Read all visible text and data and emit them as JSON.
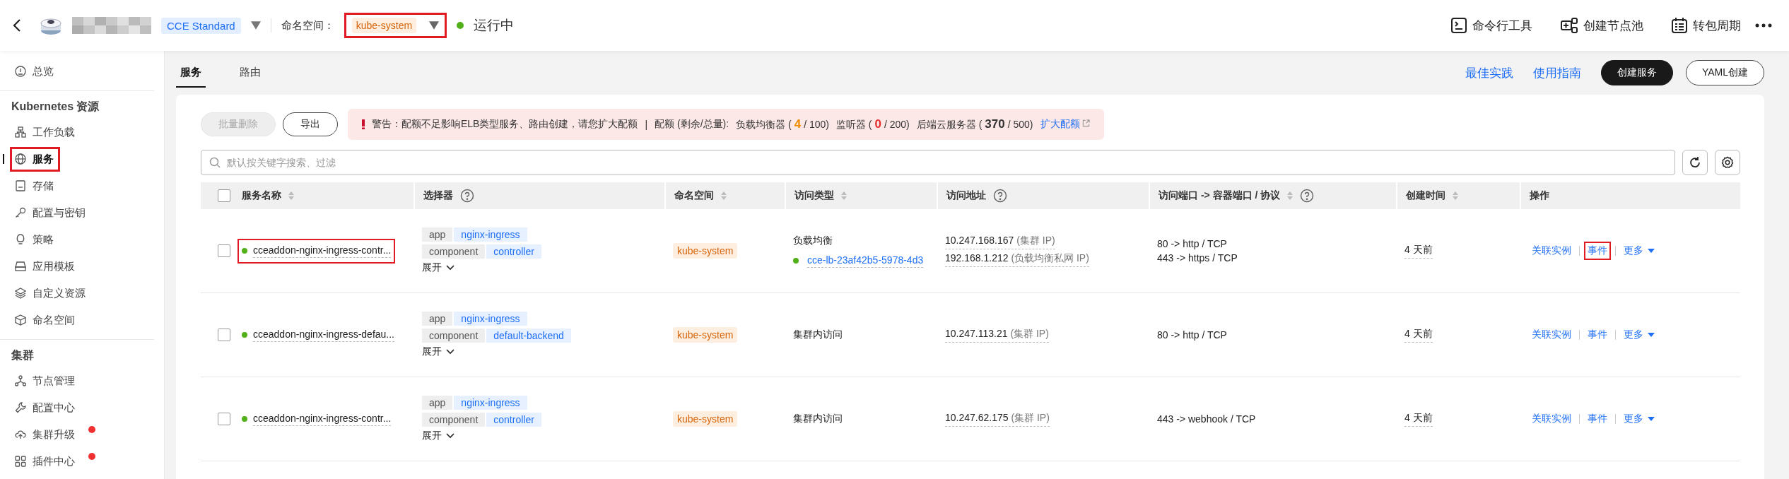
{
  "topbar": {
    "cluster_badge": "CCE Standard",
    "namespace_label": "命名空间：",
    "namespace": {
      "value": "kube-system",
      "highlighted": true
    },
    "status": "运行中",
    "actions": [
      {
        "label": "命令行工具"
      },
      {
        "label": "创建节点池"
      },
      {
        "label": "转包周期"
      }
    ]
  },
  "sidebar": {
    "sections": [
      {
        "items": [
          {
            "label": "总览",
            "selected": false,
            "highlighted": false,
            "alert": false
          }
        ]
      },
      {
        "title": "Kubernetes 资源",
        "items": [
          {
            "label": "工作负载",
            "selected": false,
            "highlighted": false,
            "alert": false
          },
          {
            "label": "服务",
            "selected": true,
            "highlighted": true,
            "alert": false
          },
          {
            "label": "存储",
            "selected": false,
            "highlighted": false,
            "alert": false
          },
          {
            "label": "配置与密钥",
            "selected": false,
            "highlighted": false,
            "alert": false
          },
          {
            "label": "策略",
            "selected": false,
            "highlighted": false,
            "alert": false
          },
          {
            "label": "应用模板",
            "selected": false,
            "highlighted": false,
            "alert": false
          },
          {
            "label": "自定义资源",
            "selected": false,
            "highlighted": false,
            "alert": false
          },
          {
            "label": "命名空间",
            "selected": false,
            "highlighted": false,
            "alert": false
          }
        ]
      },
      {
        "title": "集群",
        "items": [
          {
            "label": "节点管理",
            "selected": false,
            "highlighted": false,
            "alert": false
          },
          {
            "label": "配置中心",
            "selected": false,
            "highlighted": false,
            "alert": false
          },
          {
            "label": "集群升级",
            "selected": false,
            "highlighted": false,
            "alert": true
          },
          {
            "label": "插件中心",
            "selected": false,
            "highlighted": false,
            "alert": true
          }
        ]
      }
    ]
  },
  "tabs": [
    {
      "label": "服务",
      "selected": true
    },
    {
      "label": "路由",
      "selected": false
    }
  ],
  "header_links": [
    "最佳实践",
    "使用指南"
  ],
  "header_buttons": [
    {
      "label": "创建服务",
      "primary": true
    },
    {
      "label": "YAML创建",
      "primary": false
    }
  ],
  "toolbar": {
    "buttons": [
      {
        "label": "批量删除",
        "disabled": true
      },
      {
        "label": "导出",
        "disabled": false
      }
    ]
  },
  "warning": {
    "message": "警告：配额不足影响ELB类型服务、路由创建，请您扩大配额",
    "separator": "|",
    "quota_label": "配额 (剩余/总量):",
    "quotas": [
      {
        "label": "负载均衡器 (",
        "value": "4",
        "total": "/ 100)",
        "color": "#f08c00"
      },
      {
        "label": "监听器 (",
        "value": "0",
        "total": "/ 200)",
        "color": "#e62e2e"
      },
      {
        "label": "后端云服务器 (",
        "value": "370",
        "total": "/ 500)",
        "color": "#333333"
      }
    ],
    "link": "扩大配额"
  },
  "search": {
    "placeholder": "默认按关键字搜索、过滤"
  },
  "table": {
    "select_all": {
      "checked": false
    },
    "columns": [
      {
        "label": "服务名称",
        "sortable": true,
        "help": false
      },
      {
        "label": "选择器",
        "sortable": false,
        "help": true
      },
      {
        "label": "命名空间",
        "sortable": true,
        "help": false
      },
      {
        "label": "访问类型",
        "sortable": true,
        "help": false
      },
      {
        "label": "访问地址",
        "sortable": false,
        "help": true
      },
      {
        "label": "访问端口 -> 容器端口 / 协议",
        "sortable": true,
        "help": true
      },
      {
        "label": "创建时间",
        "sortable": true,
        "help": false
      },
      {
        "label": "操作",
        "sortable": false,
        "help": false
      }
    ],
    "rows": [
      {
        "checked": false,
        "name": "cceaddon-nginx-ingress-contr...",
        "name_highlighted": true,
        "selector": [
          {
            "key": "app",
            "value": "nginx-ingress"
          },
          {
            "key": "component",
            "value": "controller"
          }
        ],
        "expand": "展开",
        "namespace": "kube-system",
        "access_type": "负载均衡",
        "load_balancer": "cce-lb-23af42b5-5978-4d3",
        "addresses": [
          {
            "ip": "10.247.168.167",
            "note": "(集群 IP)"
          },
          {
            "ip": "192.168.1.212",
            "note": "(负载均衡私网 IP)"
          }
        ],
        "ports": [
          "80 -> http / TCP",
          "443 -> https / TCP"
        ],
        "created": "4 天前",
        "actions": [
          {
            "label": "关联实例",
            "highlighted": false
          },
          {
            "label": "事件",
            "highlighted": true
          },
          {
            "label": "更多",
            "highlighted": false
          }
        ]
      },
      {
        "checked": false,
        "name": "cceaddon-nginx-ingress-defau...",
        "name_highlighted": false,
        "selector": [
          {
            "key": "app",
            "value": "nginx-ingress"
          },
          {
            "key": "component",
            "value": "default-backend"
          }
        ],
        "expand": "展开",
        "namespace": "kube-system",
        "access_type": "集群内访问",
        "addresses": [
          {
            "ip": "10.247.113.21",
            "note": "(集群 IP)"
          }
        ],
        "ports": [
          "80 -> http / TCP"
        ],
        "created": "4 天前",
        "actions": [
          {
            "label": "关联实例",
            "highlighted": false
          },
          {
            "label": "事件",
            "highlighted": false
          },
          {
            "label": "更多",
            "highlighted": false
          }
        ]
      },
      {
        "checked": false,
        "name": "cceaddon-nginx-ingress-contr...",
        "name_highlighted": false,
        "selector": [
          {
            "key": "app",
            "value": "nginx-ingress"
          },
          {
            "key": "component",
            "value": "controller"
          }
        ],
        "expand": "展开",
        "namespace": "kube-system",
        "access_type": "集群内访问",
        "addresses": [
          {
            "ip": "10.247.62.175",
            "note": "(集群 IP)"
          }
        ],
        "ports": [
          "443 -> webhook / TCP"
        ],
        "created": "4 天前",
        "actions": [
          {
            "label": "关联实例",
            "highlighted": false
          },
          {
            "label": "事件",
            "highlighted": false
          },
          {
            "label": "更多",
            "highlighted": false
          }
        ]
      }
    ]
  }
}
